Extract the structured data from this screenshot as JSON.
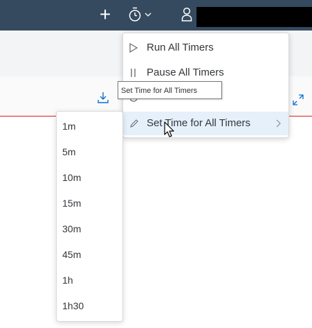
{
  "topbar": {
    "plus_icon": "plus-icon",
    "timer_icon": "stopwatch-icon",
    "chevron_icon": "chevron-down-icon",
    "user_icon": "user-icon",
    "bg_color": "#354a5f"
  },
  "toolbar": {
    "download_icon": "download-icon",
    "expand_icon": "fullscreen-icon",
    "accent_line_color": "#e11b1b"
  },
  "timer_menu": {
    "items": [
      {
        "label": "Run All Timers",
        "icon": "play-icon"
      },
      {
        "label": "Pause All Timers",
        "icon": "pause-icon"
      },
      {
        "label": "",
        "icon": "reset-icon"
      },
      {
        "label": "Set Time for All Timers",
        "icon": "pencil-icon",
        "has_submenu": true,
        "highlighted": true
      }
    ]
  },
  "tooltip": {
    "text": "Set Time for All Timers"
  },
  "time_submenu": {
    "items": [
      "1m",
      "5m",
      "10m",
      "15m",
      "30m",
      "45m",
      "1h",
      "1h30"
    ]
  }
}
